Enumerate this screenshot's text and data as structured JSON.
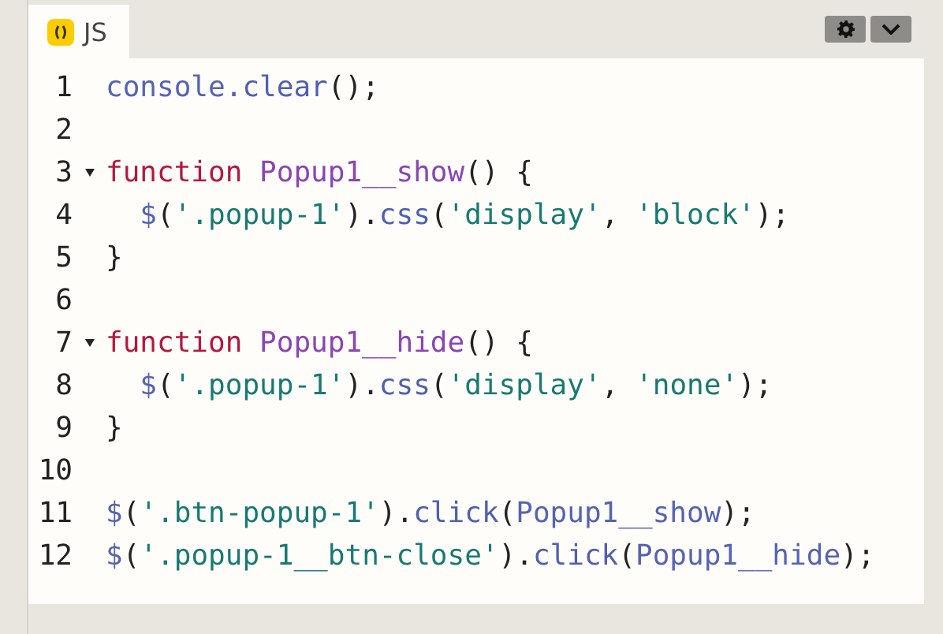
{
  "tab": {
    "label": "JS",
    "selected": true
  },
  "toolbar": {
    "buttons": [
      {
        "kind": "settings"
      },
      {
        "kind": "collapse"
      }
    ]
  },
  "lines": [
    {
      "number": "1",
      "foldable": false,
      "tokens": [
        {
          "kind": "variable",
          "text": "console"
        },
        {
          "kind": "property",
          "text": ".clear"
        },
        {
          "kind": "punct",
          "text": "();"
        }
      ]
    },
    {
      "number": "2",
      "foldable": false
    },
    {
      "number": "3",
      "foldable": true,
      "tokens": [
        {
          "kind": "keyword",
          "text": "function"
        },
        {
          "kind": "def",
          "text": " Popup1__show"
        },
        {
          "kind": "punct",
          "text": "() {"
        }
      ]
    },
    {
      "number": "4",
      "foldable": false,
      "tokens": [
        {
          "kind": "variable",
          "text": "  $"
        },
        {
          "kind": "punct",
          "text": "("
        },
        {
          "kind": "string",
          "text": "'.popup-1'"
        },
        {
          "kind": "punct",
          "text": ")."
        },
        {
          "kind": "property",
          "text": "css"
        },
        {
          "kind": "punct",
          "text": "("
        },
        {
          "kind": "string",
          "text": "'display'"
        },
        {
          "kind": "punct",
          "text": ", "
        },
        {
          "kind": "string",
          "text": "'block'"
        },
        {
          "kind": "punct",
          "text": ");"
        }
      ]
    },
    {
      "number": "5",
      "foldable": false,
      "tokens": [
        {
          "kind": "punct",
          "text": "}"
        }
      ]
    },
    {
      "number": "6",
      "foldable": false
    },
    {
      "number": "7",
      "foldable": true,
      "tokens": [
        {
          "kind": "keyword",
          "text": "function"
        },
        {
          "kind": "def",
          "text": " Popup1__hide"
        },
        {
          "kind": "punct",
          "text": "() {"
        }
      ]
    },
    {
      "number": "8",
      "foldable": false,
      "tokens": [
        {
          "kind": "variable",
          "text": "  $"
        },
        {
          "kind": "punct",
          "text": "("
        },
        {
          "kind": "string",
          "text": "'.popup-1'"
        },
        {
          "kind": "punct",
          "text": ")."
        },
        {
          "kind": "property",
          "text": "css"
        },
        {
          "kind": "punct",
          "text": "("
        },
        {
          "kind": "string",
          "text": "'display'"
        },
        {
          "kind": "punct",
          "text": ", "
        },
        {
          "kind": "string",
          "text": "'none'"
        },
        {
          "kind": "punct",
          "text": ");"
        }
      ]
    },
    {
      "number": "9",
      "foldable": false,
      "tokens": [
        {
          "kind": "punct",
          "text": "}"
        }
      ]
    },
    {
      "number": "10",
      "foldable": false
    },
    {
      "number": "11",
      "foldable": false,
      "tokens": [
        {
          "kind": "variable",
          "text": "$"
        },
        {
          "kind": "punct",
          "text": "("
        },
        {
          "kind": "string",
          "text": "'.btn-popup-1'"
        },
        {
          "kind": "punct",
          "text": ")."
        },
        {
          "kind": "property",
          "text": "click"
        },
        {
          "kind": "punct",
          "text": "("
        },
        {
          "kind": "variable",
          "text": "Popup1__show"
        },
        {
          "kind": "punct",
          "text": ");"
        }
      ]
    },
    {
      "number": "12",
      "foldable": false,
      "tokens": [
        {
          "kind": "variable",
          "text": "$"
        },
        {
          "kind": "punct",
          "text": "("
        },
        {
          "kind": "string",
          "text": "'.popup-1__btn-close'"
        },
        {
          "kind": "punct",
          "text": ")."
        },
        {
          "kind": "property",
          "text": "click"
        },
        {
          "kind": "punct",
          "text": "("
        },
        {
          "kind": "variable",
          "text": "Popup1__hide"
        },
        {
          "kind": "punct",
          "text": ");"
        }
      ]
    }
  ]
}
